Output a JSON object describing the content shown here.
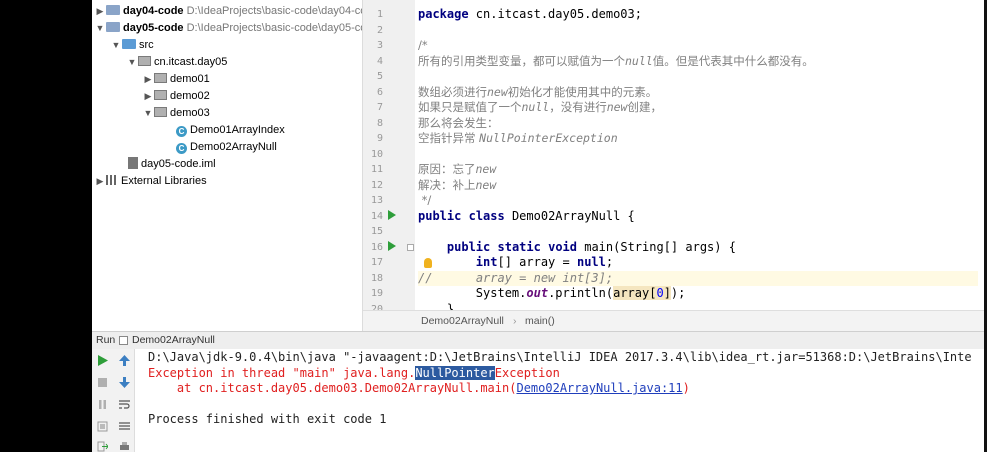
{
  "project_tree": {
    "rows": [
      {
        "name": "day04-code",
        "path": "D:\\IdeaProjects\\basic-code\\day04-code"
      },
      {
        "name": "day05-code",
        "path": "D:\\IdeaProjects\\basic-code\\day05-code"
      },
      {
        "name": "src"
      },
      {
        "name": "cn.itcast.day05"
      },
      {
        "name": "demo01"
      },
      {
        "name": "demo02"
      },
      {
        "name": "demo03"
      },
      {
        "name": "Demo01ArrayIndex"
      },
      {
        "name": "Demo02ArrayNull"
      },
      {
        "name": "day05-code.iml"
      },
      {
        "name": "External Libraries"
      }
    ]
  },
  "editor": {
    "line_numbers": [
      "1",
      "2",
      "3",
      "4",
      "5",
      "6",
      "7",
      "8",
      "9",
      "10",
      "11",
      "12",
      "13",
      "14",
      "15",
      "16",
      "17",
      "18",
      "19",
      "20"
    ],
    "lines": {
      "l1_kw": "package",
      "l1_rest": " cn.itcast.day05.demo03;",
      "l3": "/*",
      "l4_a": "所有的引用类型变量，都可以赋值为一个",
      "l4_b": "null",
      "l4_c": "值。但是代表其中什么都没有。",
      "l6_a": "数组必须进行",
      "l6_b": "new",
      "l6_c": "初始化才能使用其中的元素。",
      "l7_a": "如果只是赋值了一个",
      "l7_b": "null",
      "l7_c": "，没有进行",
      "l7_d": "new",
      "l7_e": "创建，",
      "l8": "那么将会发生：",
      "l9_a": "空指针异常 ",
      "l9_b": "NullPointerException",
      "l11_a": "原因：忘了",
      "l11_b": "new",
      "l12_a": "解决：补上",
      "l12_b": "new",
      "l13": " */",
      "l14_kw1": "public",
      "l14_kw2": "class",
      "l14_rest": " Demo02ArrayNull {",
      "l16_kw1": "public",
      "l16_kw2": "static",
      "l16_kw3": "void",
      "l16_rest": " main(String[] args) {",
      "l17_kw": "int",
      "l17_mid": "[] array = ",
      "l17_null": "null",
      "l17_end": ";",
      "l18_a": "//",
      "l18_b": "array = new int[3];",
      "l19_a": "System.",
      "l19_field": "out",
      "l19_b": ".println(",
      "l19_hl": "array[",
      "l19_num": "0",
      "l19_hl2": "]",
      "l19_end": ");",
      "l20": "}"
    },
    "breadcrumb": {
      "class": "Demo02ArrayNull",
      "method": "main()"
    }
  },
  "run": {
    "tab_label": "Run",
    "config_name": "Demo02ArrayNull",
    "console": {
      "line1": "D:\\Java\\jdk-9.0.4\\bin\\java \"-javaagent:D:\\JetBrains\\IntelliJ IDEA 2017.3.4\\lib\\idea_rt.jar=51368:D:\\JetBrains\\Inte",
      "line2_a": "Exception in thread \"main\" java.lang.",
      "line2_sel": "NullPointer",
      "line2_b": "Exception",
      "line3_a": "    at cn.itcast.day05.demo03.Demo02ArrayNull.main(",
      "line3_link": "Demo02ArrayNull.java:11",
      "line3_b": ")",
      "line5": "Process finished with exit code 1"
    }
  }
}
